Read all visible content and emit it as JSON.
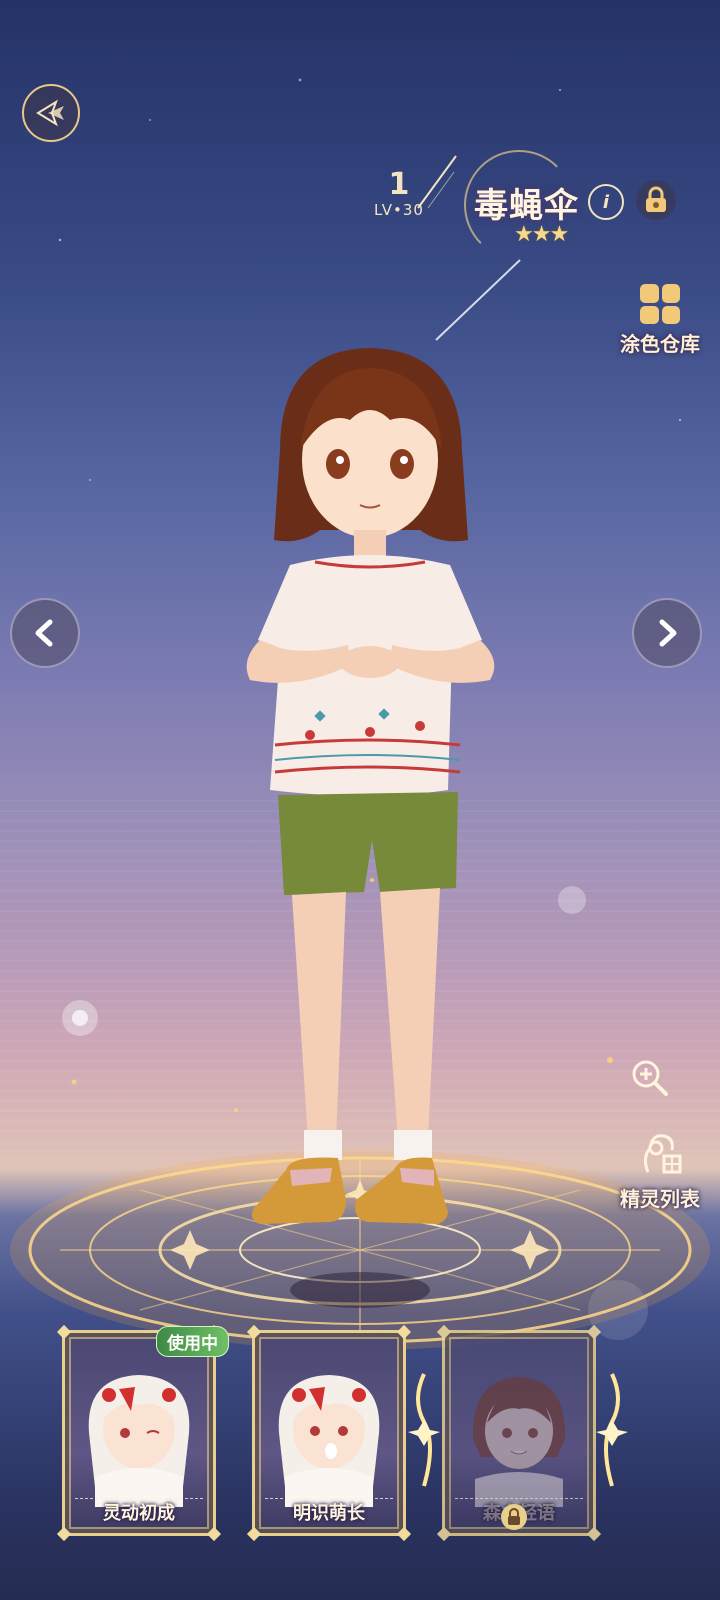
{
  "header": {
    "level_current": "1",
    "level_label": "LV",
    "level_max": "30",
    "spirit_name": "毒蝇伞",
    "stars": 3
  },
  "sidebar": {
    "paint_library_label": "涂色仓库",
    "spirit_list_label": "精灵列表"
  },
  "cards": [
    {
      "name": "灵动初成",
      "status": "使用中",
      "locked": false
    },
    {
      "name": "明识萌长",
      "status": "",
      "locked": false
    },
    {
      "name": "森之轻语",
      "status": "",
      "locked": true
    }
  ],
  "icons": {
    "back": "back-emblem-icon",
    "edit": "edit-icon",
    "lock": "lock-icon",
    "paint_library": "palette-grid-icon",
    "zoom": "zoom-in-icon",
    "spirit_list": "spirit-list-icon",
    "prev": "chevron-left-icon",
    "next": "chevron-right-icon"
  },
  "colors": {
    "gold": "#e9cf8c",
    "in_use_green": "#6fc065",
    "text_light": "#fff4e0"
  }
}
